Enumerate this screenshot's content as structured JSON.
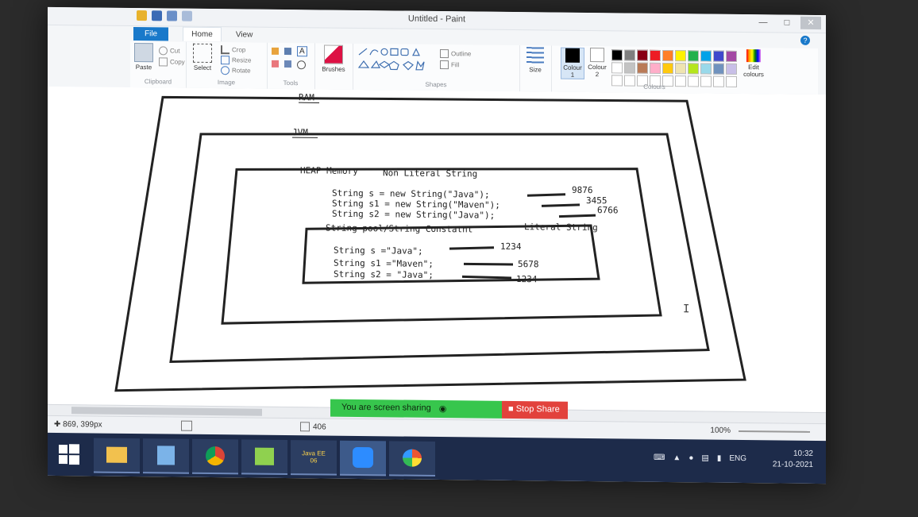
{
  "window": {
    "title": "Untitled - Paint"
  },
  "tabs": {
    "file": "File",
    "home": "Home",
    "view": "View"
  },
  "ribbon": {
    "clipboard": {
      "paste": "Paste",
      "cut": "Cut",
      "copy": "Copy",
      "label": "Clipboard"
    },
    "image": {
      "select": "Select",
      "crop": "Crop",
      "resize": "Resize",
      "rotate": "Rotate",
      "label": "Image"
    },
    "tools": {
      "label": "Tools",
      "text_glyph": "A"
    },
    "brushes": {
      "label": "Brushes"
    },
    "shapes": {
      "outline": "Outline",
      "fill": "Fill",
      "label": "Shapes"
    },
    "size": {
      "label": "Size"
    },
    "colours": {
      "colour1": "Colour",
      "colour1_num": "1",
      "colour2": "Colour",
      "colour2_num": "2",
      "edit": "Edit colours",
      "label": "Colours"
    },
    "palette": [
      "#000000",
      "#7f7f7f",
      "#880015",
      "#ed1c24",
      "#ff7f27",
      "#fff200",
      "#22b14c",
      "#00a2e8",
      "#3f48cc",
      "#a349a4",
      "#ffffff",
      "#c3c3c3",
      "#b97a57",
      "#ffaec9",
      "#ffc90e",
      "#efe4b0",
      "#b5e61d",
      "#99d9ea",
      "#7092be",
      "#c8bfe7",
      "#ffffff",
      "#ffffff",
      "#ffffff",
      "#ffffff",
      "#ffffff",
      "#ffffff",
      "#ffffff",
      "#ffffff",
      "#ffffff",
      "#ffffff"
    ]
  },
  "drawing": {
    "ram_label": "RAM",
    "jvm_label": "JVM",
    "heap_label": "HEAP Memory",
    "non_literal_label": "Non Literal String",
    "heap_lines": [
      {
        "code": "String s = new String(\"Java\");",
        "addr": "9876"
      },
      {
        "code": "String s1 = new String(\"Maven\");",
        "addr": "3455"
      },
      {
        "code": "String s2 = new String(\"Java\");",
        "addr": "6766"
      }
    ],
    "pool_label": "String pool/String Constatnt",
    "literal_label": "Literal String",
    "pool_lines": [
      {
        "code": "String s =\"Java\";",
        "addr": "1234"
      },
      {
        "code": "String s1 =\"Maven\";",
        "addr": "5678"
      },
      {
        "code": "String s2 = \"Java\";",
        "addr": "1234"
      }
    ]
  },
  "statusbar": {
    "cursor": "869, 399px",
    "size": "406",
    "zoom": "100%"
  },
  "screenshare": {
    "status": "You are screen sharing",
    "stop": "Stop Share"
  },
  "taskbar": {
    "lang": "ENG",
    "time": "10:32",
    "date": "21-10-2021",
    "app_label": "Java EE 06"
  }
}
